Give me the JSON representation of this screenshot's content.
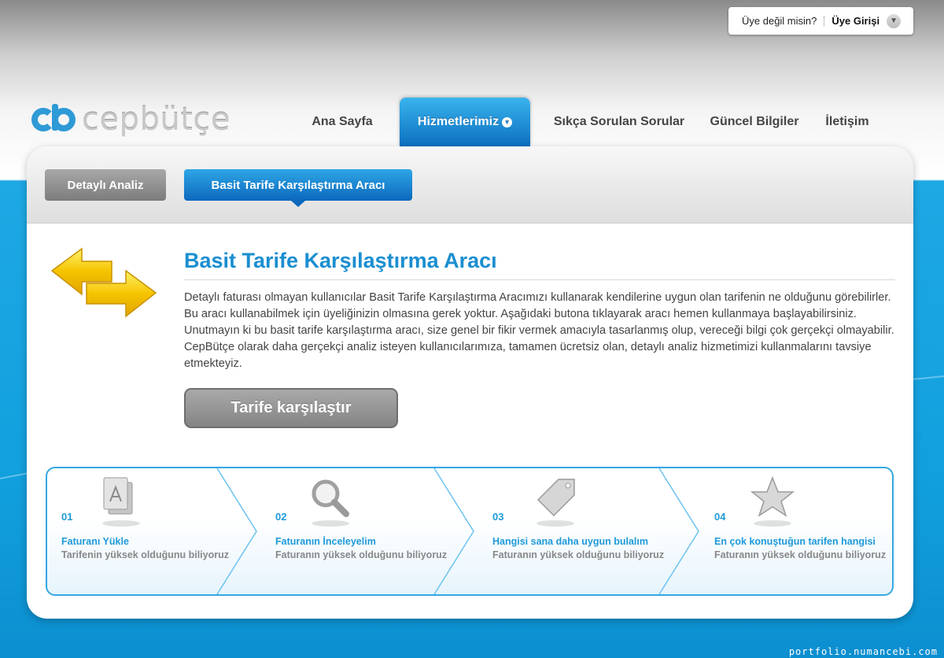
{
  "header": {
    "member_question": "Üye değil misin?",
    "login_label": "Üye Girişi",
    "logo_text": "cepbütçe"
  },
  "nav": {
    "items": [
      {
        "label": "Ana Sayfa"
      },
      {
        "label": "Hizmetlerimiz"
      },
      {
        "label": "Sıkça Sorulan Sorular"
      },
      {
        "label": "Güncel Bilgiler"
      },
      {
        "label": "İletişim"
      }
    ],
    "active": "Hizmetlerimiz"
  },
  "subnav": {
    "tabs": [
      {
        "label": "Detaylı Analiz"
      },
      {
        "label": "Basit Tarife Karşılaştırma Aracı"
      }
    ],
    "active": "Basit Tarife Karşılaştırma Aracı"
  },
  "main": {
    "title": "Basit Tarife Karşılaştırma Aracı",
    "intro": "Detaylı faturası olmayan kullanıcılar Basit Tarife Karşılaştırma Aracımızı kullanarak kendilerine uygun olan tarifenin ne olduğunu görebilirler. Bu aracı kullanabilmek için üyeliğinizin olmasına gerek yoktur. Aşağıdaki butona tıklayarak aracı hemen kullanmaya başlayabilirsiniz. Unutmayın ki bu basit tarife karşılaştırma aracı, size genel bir fikir vermek amacıyla tasarlanmış olup, vereceği bilgi çok gerçekçi olmayabilir. CepBütçe olarak daha gerçekçi analiz isteyen kullanıcılarımıza, tamamen ücretsiz olan, detaylı analiz hizmetimizi kullanmalarını tavsiye etmekteyiz.",
    "cta_label": "Tarife karşılaştır"
  },
  "steps": [
    {
      "num": "01",
      "title": "Faturanı Yükle",
      "subtitle": "Tarifenin yüksek olduğunu biliyoruz",
      "icon": "document-icon"
    },
    {
      "num": "02",
      "title": "Faturanın İnceleyelim",
      "subtitle": "Faturanın yüksek olduğunu biliyoruz",
      "icon": "magnifier-icon"
    },
    {
      "num": "03",
      "title": "Hangisi sana daha uygun bulalım",
      "subtitle": "Faturanın yüksek olduğunu biliyoruz",
      "icon": "tag-icon"
    },
    {
      "num": "04",
      "title": "En çok konuştuğun tarifen hangisi",
      "subtitle": "Faturanın yüksek olduğunu biliyoruz",
      "icon": "star-icon"
    }
  ],
  "watermark": "portfolio.numancebi.com",
  "colors": {
    "brand_blue": "#1a8ed0",
    "sky_blue": "#12a0de",
    "active_tab_top": "#39b4ee",
    "active_tab_bottom": "#0c6fc0",
    "step_accent": "#1e9ad9",
    "arrow_yellow": "#f5c400"
  }
}
